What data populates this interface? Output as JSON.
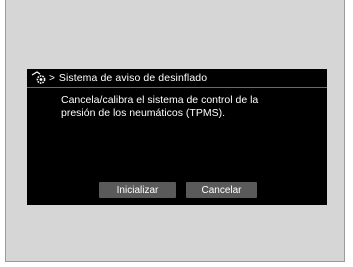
{
  "header": {
    "icon": "settings-gear-icon",
    "separator": ">",
    "title": "Sistema de aviso de desinflado"
  },
  "message": {
    "line1": "Cancela/calibra el sistema de control de la",
    "line2": "presión de los neumáticos (TPMS)."
  },
  "buttons": {
    "initialize_label": "Inicializar",
    "cancel_label": "Cancelar"
  },
  "colors": {
    "screen_background": "#000000",
    "button_background": "#5a5a5a",
    "text": "#ffffff",
    "frame": "#d6d6d6"
  }
}
